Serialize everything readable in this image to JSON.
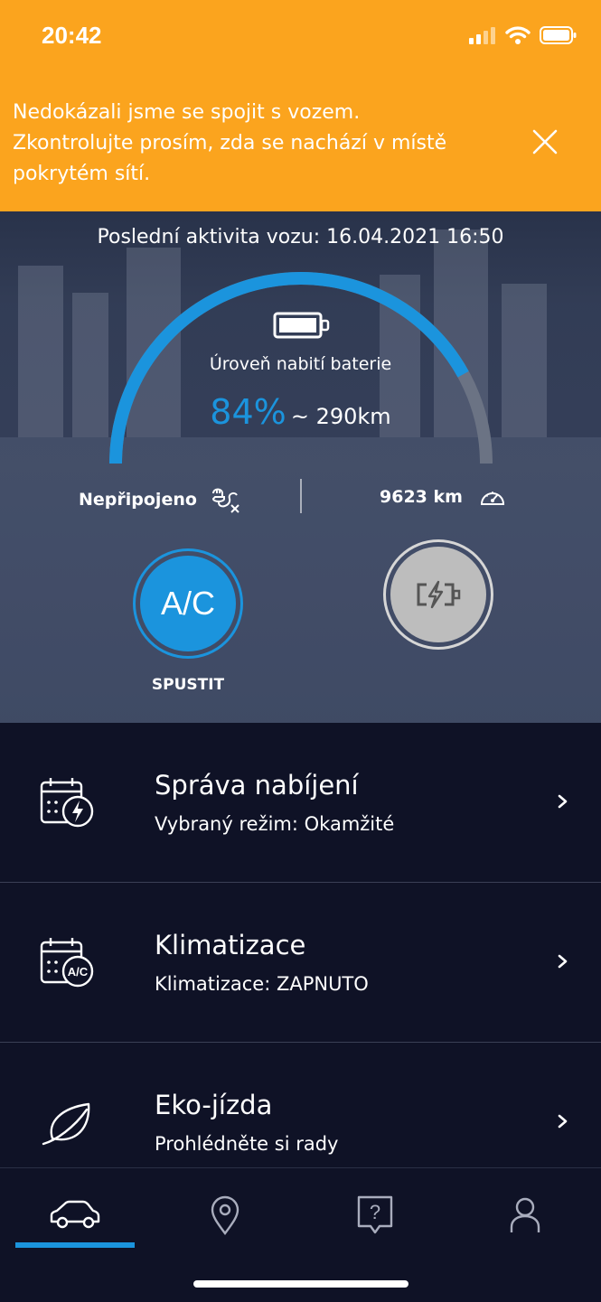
{
  "status_bar": {
    "time": "20:42"
  },
  "alert": {
    "line1": "Nedokázali jsme se spojit s vozem.",
    "line2": "Zkontrolujte prosím, zda se nachází v místě",
    "line3": "pokrytém sítí."
  },
  "hero": {
    "last_activity": "Poslední aktivita vozu: 16.04.2021 16:50",
    "battery_label": "Úroveň nabití baterie",
    "battery_percent": "84%",
    "battery_level": 0.84,
    "range": "~ 290km",
    "plug_status": "Nepřipojeno",
    "odometer": "9623 km",
    "ac_label": "A/C",
    "ac_caption": "SPUSTIT"
  },
  "list": [
    {
      "title": "Správa nabíjení",
      "subtitle": "Vybraný režim: Okamžité",
      "icon": "calendar-charge-icon"
    },
    {
      "title": "Klimatizace",
      "subtitle": "Klimatizace: ZAPNUTO",
      "icon": "calendar-ac-icon"
    },
    {
      "title": "Eko-jízda",
      "subtitle": "Prohlédněte si rady",
      "icon": "leaf-icon"
    }
  ],
  "tabs": [
    {
      "name": "car-icon",
      "active": true
    },
    {
      "name": "map-pin-icon",
      "active": false
    },
    {
      "name": "help-icon",
      "active": false
    },
    {
      "name": "profile-icon",
      "active": false
    }
  ],
  "colors": {
    "alert": "#fba41e",
    "accent": "#1b94dd",
    "background": "#0f1226"
  }
}
